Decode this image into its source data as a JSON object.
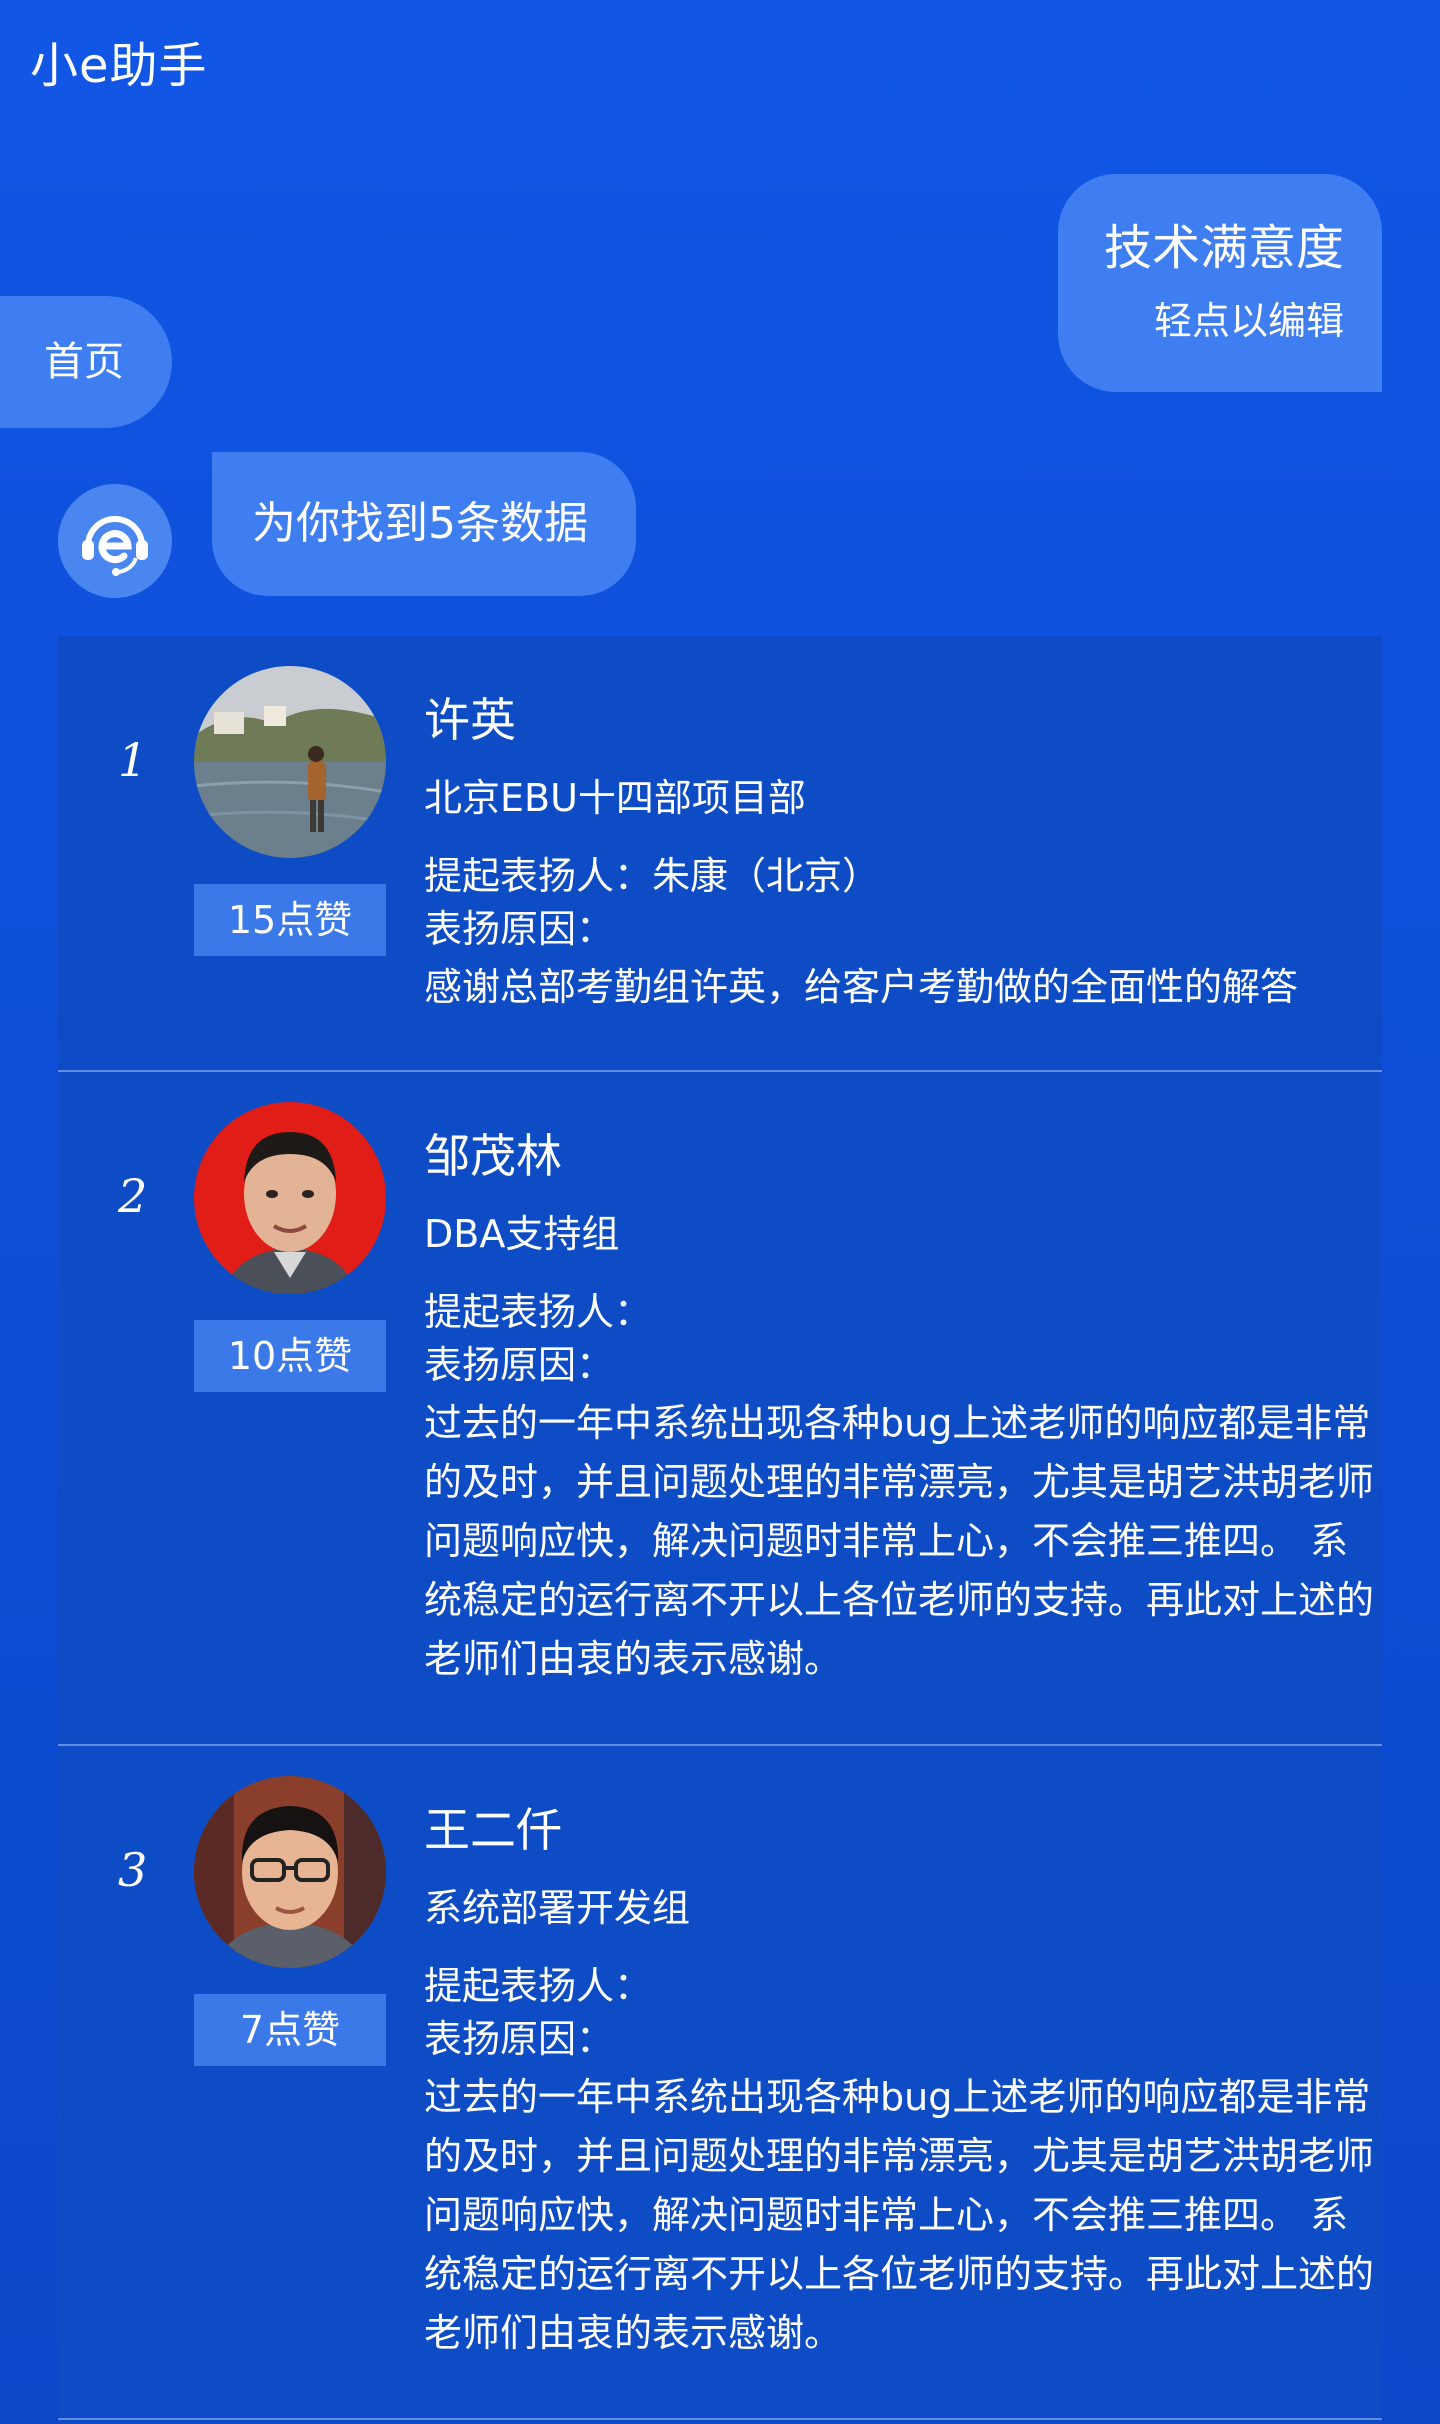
{
  "header": {
    "title": "小e助手"
  },
  "user_message": {
    "query": "技术满意度",
    "edit_hint": "轻点以编辑"
  },
  "home_button": {
    "label": "首页"
  },
  "bot": {
    "avatar_icon": "headset-e-icon",
    "message": "为你找到5条数据"
  },
  "results": [
    {
      "rank": "1",
      "name": "许英",
      "department": "北京EBU十四部项目部",
      "likes": "15点赞",
      "praiser": "提起表扬人：朱康（北京）",
      "reason_label": "表扬原因：",
      "reason": "感谢总部考勤组许英，给客户考勤做的全面性的解答"
    },
    {
      "rank": "2",
      "name": "邹茂林",
      "department": "DBA支持组",
      "likes": "10点赞",
      "praiser": "提起表扬人：",
      "reason_label": "表扬原因：",
      "reason": "过去的一年中系统出现各种bug上述老师的响应都是非常的及时，并且问题处理的非常漂亮，尤其是胡艺洪胡老师问题响应快，解决问题时非常上心，不会推三推四。 系统稳定的运行离不开以上各位老师的支持。再此对上述的老师们由衷的表示感谢。"
    },
    {
      "rank": "3",
      "name": "王二仟",
      "department": "系统部署开发组",
      "likes": "7点赞",
      "praiser": "提起表扬人：",
      "reason_label": "表扬原因：",
      "reason": "过去的一年中系统出现各种bug上述老师的响应都是非常的及时，并且问题处理的非常漂亮，尤其是胡艺洪胡老师问题响应快，解决问题时非常上心，不会推三推四。 系统稳定的运行离不开以上各位老师的支持。再此对上述的老师们由衷的表示感谢。"
    }
  ]
}
